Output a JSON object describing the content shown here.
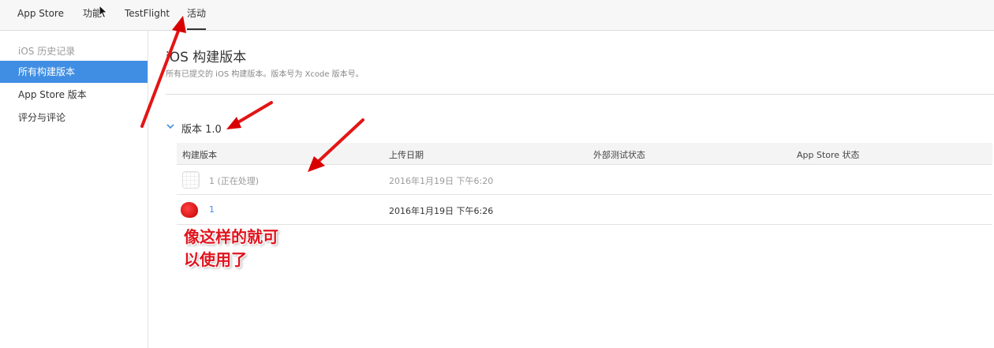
{
  "topnav": {
    "tabs": [
      {
        "label": "App Store"
      },
      {
        "label": "功能"
      },
      {
        "label": "TestFlight"
      },
      {
        "label": "活动"
      }
    ]
  },
  "sidebar": {
    "section_title": "iOS 历史记录",
    "items": [
      {
        "label": "所有构建版本"
      },
      {
        "label": "App Store 版本"
      },
      {
        "label": "评分与评论"
      }
    ]
  },
  "main": {
    "title": "iOS 构建版本",
    "subtitle": "所有已提交的 iOS 构建版本。版本号为 Xcode 版本号。",
    "version_label": "版本 1.0",
    "table": {
      "headers": [
        "构建版本",
        "上传日期",
        "外部测试状态",
        "App Store 状态"
      ],
      "rows": [
        {
          "build": "1  (正在处理)",
          "upload_date": "2016年1月19日 下午6:20",
          "external_status": "",
          "appstore_status": "",
          "icon": "app-icon-placeholder",
          "state": "processing"
        },
        {
          "build": "1",
          "upload_date": "2016年1月19日 下午6:26",
          "external_status": "",
          "appstore_status": "",
          "icon": "app-icon",
          "state": "ready"
        }
      ]
    }
  },
  "annotation": {
    "line1": "像这样的就可",
    "line2": "以使用了"
  },
  "colors": {
    "accent": "#3f8ee4",
    "annotation_red": "#e0141e"
  },
  "icons": {
    "chevron": "chevron-down-icon",
    "cursor": "mouse-cursor-icon",
    "arrow": "red-annotation-arrow-icon"
  }
}
